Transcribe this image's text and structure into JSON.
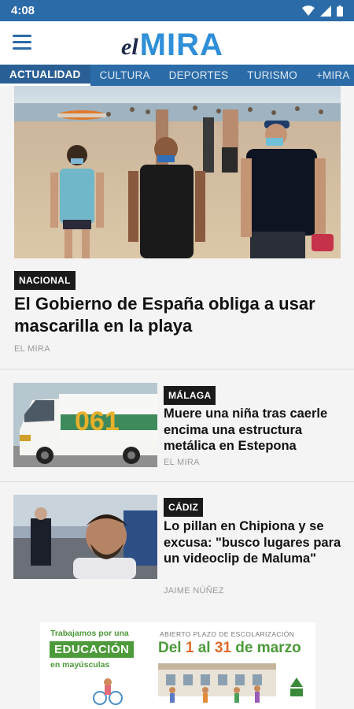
{
  "status_bar": {
    "time": "4:08"
  },
  "app": {
    "logo_prefix": "el",
    "logo_main": "MIRA"
  },
  "nav": {
    "tabs": [
      {
        "label": "ACTUALIDAD",
        "active": true
      },
      {
        "label": "CULTURA",
        "active": false
      },
      {
        "label": "DEPORTES",
        "active": false
      },
      {
        "label": "TURISMO",
        "active": false
      },
      {
        "label": "+MIRA",
        "active": false
      }
    ]
  },
  "hero": {
    "category": "NACIONAL",
    "title": "El Gobierno de España obliga a usar mascarilla en la playa",
    "source": "EL MIRA"
  },
  "articles": [
    {
      "category": "MÁLAGA",
      "title": "Muere una niña tras caerle encima una estructura metálica en Estepona",
      "source": "EL MIRA"
    },
    {
      "category": "CÁDIZ",
      "title": "Lo pillan en Chipiona y se excusa: \"busco lugares para un videoclip de Maluma\"",
      "source": "JAIME NÚÑEZ"
    }
  ],
  "ad": {
    "line1": "Trabajamos por una",
    "line2": "EDUCACIÓN",
    "line3": "en mayúsculas",
    "right_top": "ABIERTO PLAZO DE ESCOLARIZACIÓN",
    "right_main_pre": "Del ",
    "right_main_n1": "1",
    "right_main_mid": " al ",
    "right_main_n2": "31",
    "right_main_post": " de marzo"
  },
  "colors": {
    "brand_blue": "#2b6ba8",
    "logo_blue": "#2f8fd8",
    "ad_green": "#4c9a3a"
  }
}
